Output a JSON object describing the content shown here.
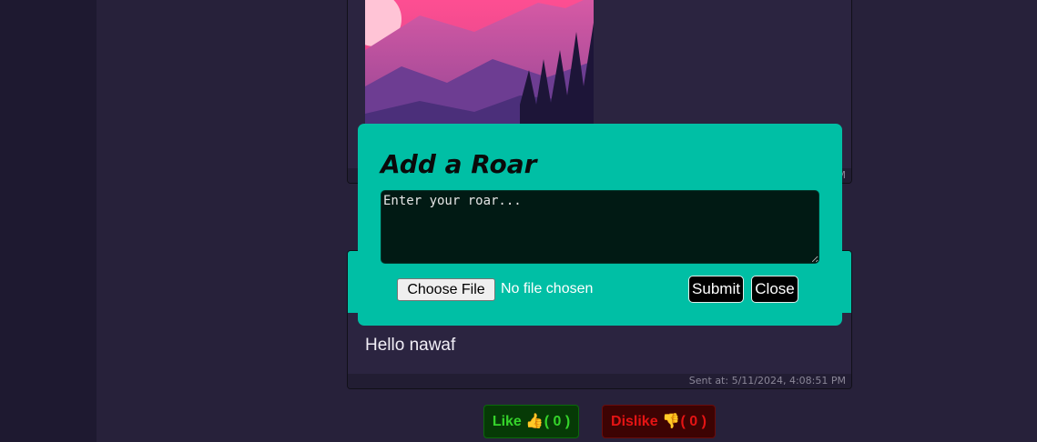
{
  "previous_post": {
    "sent_at_partial": "M"
  },
  "message_post": {
    "text": "Hello nawaf",
    "sent_at": "Sent at: 5/11/2024, 4:08:51 PM"
  },
  "modal": {
    "title": "Add a Roar",
    "textarea_placeholder": "Enter your roar...",
    "choose_file_label": "Choose File",
    "file_status": "No file chosen",
    "submit_label": "Submit",
    "close_label": "Close"
  },
  "votes": {
    "like_label": "Like",
    "like_icon": "thumbs-up-icon",
    "like_count": "( 0 )",
    "dislike_label": "Dislike",
    "dislike_icon": "thumbs-down-icon",
    "dislike_count": "( 0 )"
  },
  "colors": {
    "accent": "#00bfa5",
    "background": "#27213a",
    "like": "#35d42b",
    "dislike": "#e51414"
  }
}
